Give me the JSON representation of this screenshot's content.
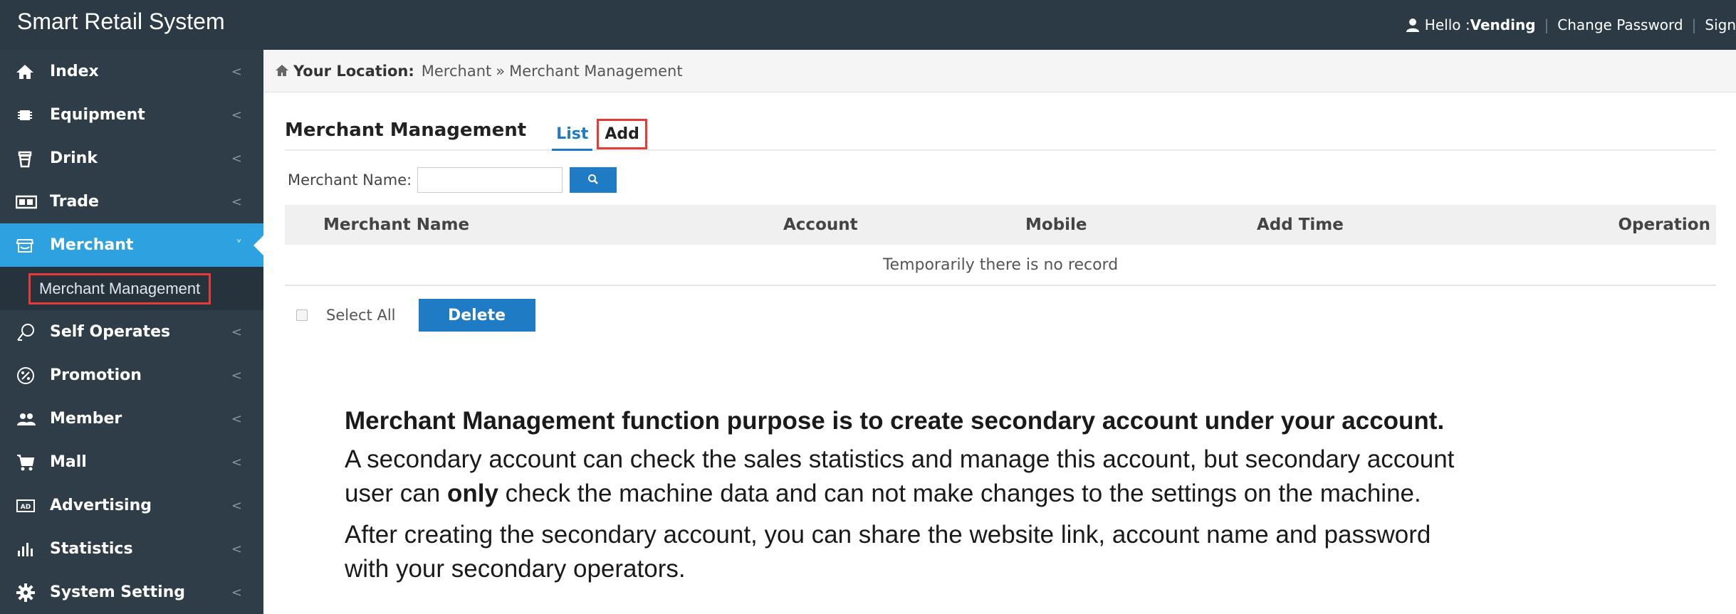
{
  "app": {
    "title": "Smart Retail System"
  },
  "header": {
    "greeting_prefix": "Hello : ",
    "username": "Vending",
    "change_password": "Change Password",
    "sign_out": "Sign"
  },
  "sidebar": {
    "items": [
      {
        "label": "Index",
        "icon": "home-icon"
      },
      {
        "label": "Equipment",
        "icon": "chip-icon"
      },
      {
        "label": "Drink",
        "icon": "cup-icon"
      },
      {
        "label": "Trade",
        "icon": "card-icon"
      },
      {
        "label": "Merchant",
        "icon": "store-icon",
        "active": true
      },
      {
        "label": "Self Operates",
        "icon": "self-operates-icon"
      },
      {
        "label": "Promotion",
        "icon": "percent-icon"
      },
      {
        "label": "Member",
        "icon": "users-icon"
      },
      {
        "label": "Mall",
        "icon": "cart-icon"
      },
      {
        "label": "Advertising",
        "icon": "ad-icon"
      },
      {
        "label": "Statistics",
        "icon": "bar-chart-icon"
      },
      {
        "label": "System Setting",
        "icon": "gear-icon"
      }
    ],
    "submenu": {
      "label": "Merchant Management"
    },
    "chevron": "<",
    "chevron_open": "˅"
  },
  "breadcrumb": {
    "label": "Your Location:",
    "items": [
      "Merchant",
      "Merchant Management"
    ],
    "separator": "»"
  },
  "page": {
    "title": "Merchant Management",
    "tabs": [
      "List",
      "Add"
    ]
  },
  "filter": {
    "label": "Merchant Name:",
    "value": "",
    "placeholder": ""
  },
  "table": {
    "columns": [
      "Merchant Name",
      "Account",
      "Mobile",
      "Add Time",
      "Operation"
    ],
    "empty_text": "Temporarily there is no record"
  },
  "actions": {
    "select_all": "Select All",
    "delete": "Delete"
  },
  "notes": {
    "heading": "Merchant Management function purpose is to create secondary account under your account.",
    "p1": "A secondary account can check the sales statistics and manage this account, but secondary account",
    "p2_prefix": "user can ",
    "p2_bold": "only",
    "p2_suffix": " check the machine data and can not make changes to the settings on the machine.",
    "p3_line1": "After creating the secondary account, you can share the website link, account name and password",
    "p3_line2": "with your secondary operators."
  },
  "colors": {
    "topbar": "#2c3a45",
    "sidebar": "#2f3d48",
    "active": "#2ea2e0",
    "primary": "#1e7bc4",
    "highlight": "#e53a36"
  }
}
